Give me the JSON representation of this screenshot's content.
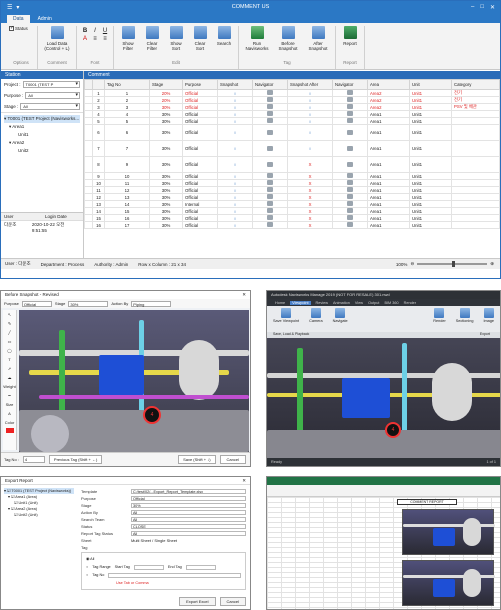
{
  "main": {
    "title": "COMMENT US",
    "tabs": [
      "Data",
      "Admin"
    ],
    "ribbon": {
      "status_label": "Status",
      "load_data": "Load Data\n(Control + L)",
      "font_buttons": [
        "B",
        "I",
        "U",
        "A",
        "≡",
        "≡"
      ],
      "buttons": [
        {
          "label": "Show\nFilter"
        },
        {
          "label": "Clear\nFilter"
        },
        {
          "label": "Show\nSort"
        },
        {
          "label": "Clear\nSort"
        },
        {
          "label": "Search"
        },
        {
          "label": "Run\nNavisworks"
        },
        {
          "label": "Before\nSnapshot"
        },
        {
          "label": "After\nSnapshot"
        },
        {
          "label": "Report"
        }
      ],
      "groups": [
        "Options",
        "Comment",
        "Font",
        "Edit",
        "Tag",
        "Report"
      ]
    },
    "left": {
      "header": "Station",
      "project_label": "Project :",
      "project_value": "T0001 (TEST P",
      "purpose_label": "Purpose :",
      "purpose_value": "All",
      "stage_label": "Stage :",
      "stage_value": "All",
      "tree": [
        {
          "text": "T0001 (TEST Project (Navisworks..."
        },
        {
          "text": "Area1"
        },
        {
          "text": "Unit1"
        },
        {
          "text": "Area2"
        },
        {
          "text": "Unit2"
        }
      ],
      "user_header": [
        "User",
        "Login Date"
      ],
      "user_row": [
        "다운조",
        "2020-10-22 오전 9:51:55"
      ]
    },
    "grid": {
      "header": "Comment",
      "columns": [
        "",
        "Tag No",
        "Stage",
        "Purpose",
        "Snapshot",
        "Navigator",
        "Snapshot After",
        "Navigator",
        "Area",
        "Unit",
        "Category"
      ],
      "rows": [
        {
          "n": "1",
          "tag": "1",
          "stage": "20%",
          "purpose": "Official",
          "snap": "○",
          "nav": "",
          "snapA": "○",
          "area": "Area2",
          "unit": "Unit1",
          "cat": "전기",
          "red": true,
          "tall": false
        },
        {
          "n": "2",
          "tag": "2",
          "stage": "20%",
          "purpose": "Official",
          "snap": "○",
          "nav": "",
          "snapA": "○",
          "area": "Area2",
          "unit": "Unit1",
          "cat": "전기",
          "red": true,
          "tall": false
        },
        {
          "n": "3",
          "tag": "3",
          "stage": "30%",
          "purpose": "Official",
          "snap": "○",
          "nav": "",
          "snapA": "○",
          "area": "Area2",
          "unit": "Unit1",
          "cat": "PSV 및 배관",
          "red": true,
          "tall": false
        },
        {
          "n": "4",
          "tag": "4",
          "stage": "30%",
          "purpose": "Official",
          "snap": "○",
          "nav": "",
          "snapA": "○",
          "area": "Area1",
          "unit": "Unit1",
          "cat": "",
          "red": false,
          "tall": false
        },
        {
          "n": "5",
          "tag": "5",
          "stage": "30%",
          "purpose": "Official",
          "snap": "○",
          "nav": "",
          "snapA": "○",
          "area": "Area1",
          "unit": "Unit1",
          "cat": "",
          "red": false,
          "tall": false
        },
        {
          "n": "6",
          "tag": "6",
          "stage": "30%",
          "purpose": "Official",
          "snap": "○",
          "nav": "",
          "snapA": "○",
          "area": "Area1",
          "unit": "Unit1",
          "cat": "",
          "red": false,
          "tall": true
        },
        {
          "n": "7",
          "tag": "7",
          "stage": "30%",
          "purpose": "Official",
          "snap": "○",
          "nav": "",
          "snapA": "○",
          "area": "Area1",
          "unit": "Unit1",
          "cat": "",
          "red": false,
          "tall": true
        },
        {
          "n": "8",
          "tag": "9",
          "stage": "30%",
          "purpose": "Official",
          "snap": "○",
          "nav": "",
          "snapA": "X",
          "area": "Area1",
          "unit": "Unit1",
          "cat": "",
          "red": false,
          "tall": true
        },
        {
          "n": "9",
          "tag": "10",
          "stage": "30%",
          "purpose": "Official",
          "snap": "○",
          "nav": "",
          "snapA": "X",
          "area": "Area1",
          "unit": "Unit1",
          "cat": "",
          "red": false,
          "tall": false
        },
        {
          "n": "10",
          "tag": "11",
          "stage": "30%",
          "purpose": "Official",
          "snap": "○",
          "nav": "",
          "snapA": "X",
          "area": "Area1",
          "unit": "Unit1",
          "cat": "",
          "red": false,
          "tall": false
        },
        {
          "n": "11",
          "tag": "12",
          "stage": "30%",
          "purpose": "Official",
          "snap": "○",
          "nav": "",
          "snapA": "X",
          "area": "Area1",
          "unit": "Unit1",
          "cat": "",
          "red": false,
          "tall": false
        },
        {
          "n": "12",
          "tag": "13",
          "stage": "30%",
          "purpose": "Official",
          "snap": "○",
          "nav": "",
          "snapA": "X",
          "area": "Area1",
          "unit": "Unit1",
          "cat": "",
          "red": false,
          "tall": false
        },
        {
          "n": "13",
          "tag": "14",
          "stage": "30%",
          "purpose": "Internal",
          "snap": "○",
          "nav": "",
          "snapA": "X",
          "area": "Area1",
          "unit": "Unit1",
          "cat": "",
          "red": false,
          "tall": false
        },
        {
          "n": "14",
          "tag": "15",
          "stage": "30%",
          "purpose": "Official",
          "snap": "○",
          "nav": "",
          "snapA": "X",
          "area": "Area1",
          "unit": "Unit1",
          "cat": "",
          "red": false,
          "tall": false
        },
        {
          "n": "15",
          "tag": "16",
          "stage": "30%",
          "purpose": "Official",
          "snap": "○",
          "nav": "",
          "snapA": "X",
          "area": "Area1",
          "unit": "Unit1",
          "cat": "",
          "red": false,
          "tall": false
        },
        {
          "n": "16",
          "tag": "17",
          "stage": "30%",
          "purpose": "Official",
          "snap": "○",
          "nav": "",
          "snapA": "X",
          "area": "Area1",
          "unit": "Unit1",
          "cat": "",
          "red": false,
          "tall": false
        }
      ]
    },
    "status": {
      "user": "User : 다운조",
      "department": "Department : Process",
      "authority": "Authority : Admin",
      "rowcol": "Row x Column : 21 x 34",
      "zoom": "100%"
    }
  },
  "before_snapshot": {
    "title": "Before Snapshot - Revised",
    "purpose_label": "Purpose",
    "purpose_value": "Official",
    "stage_label": "Stage",
    "stage_value": "30%",
    "action_label": "Action By",
    "action_value": "Piping",
    "weight_label": "Weight",
    "size_label": "Size",
    "color_label": "Color",
    "tag_label": "Tag No :",
    "tag_value": "4",
    "prev_btn": "Previous Tag (Shift + ←)",
    "save_btn": "Save (Shift + ↓)",
    "cancel_btn": "Cancel",
    "marker": "4"
  },
  "navisworks": {
    "title": "Autodesk Navisworks Manage 2019 (NOT FOR RESALE)   301.nwd",
    "tabs": [
      "Home",
      "Viewpoint",
      "Review",
      "Animation",
      "View",
      "Output",
      "BIM 360",
      "Render"
    ],
    "viewpoint_label": "Save Viewpoint",
    "camera_label": "Camera",
    "navigate_label": "Navigate",
    "render_label": "Render",
    "sectioning_label": "Sectioning",
    "image_label": "Image",
    "export_label": "Export",
    "save_load_label": "Save, Load & Playback",
    "marker": "4",
    "status_ready": "Ready",
    "page": "1 of 1"
  },
  "export_report": {
    "title": "Export Report",
    "tree": [
      "T0001 (TEST Project (Navisworks))",
      "Area1 (Area)",
      "Unit1 (Unit)",
      "Area2 (Area)",
      "Unit2 (Unit)"
    ],
    "fields": [
      {
        "label": "Template",
        "value": "C:/test/02/...Export_Report_Template.xlsx"
      },
      {
        "label": "Purpose",
        "value": "Official"
      },
      {
        "label": "Stage",
        "value": "30%"
      },
      {
        "label": "Action By",
        "value": "All"
      },
      {
        "label": "Search Team",
        "value": "All"
      },
      {
        "label": "Status",
        "value": "CLOSE"
      },
      {
        "label": "Report Tag Status",
        "value": "All"
      },
      {
        "label": "Sheet",
        "value": "Multi Sheet   /   Single Sheet"
      },
      {
        "label": "Tag",
        "value": ""
      }
    ],
    "tag_options": [
      "All",
      "Tag Range",
      "Tag No"
    ],
    "start_tag_label": "Start Tag",
    "end_tag_label": "End Tag",
    "note": "Use Tab or Comma",
    "export_btn": "Export Excel",
    "cancel_btn": "Cancel"
  },
  "excel": {
    "title": "Excel Report",
    "header_cell": "COMMENT REPORT"
  },
  "colors": {
    "accent": "#2b78c5",
    "header": "#2b6cb8",
    "red_text": "#dd2222",
    "o_mark": "#2a6ebb"
  }
}
